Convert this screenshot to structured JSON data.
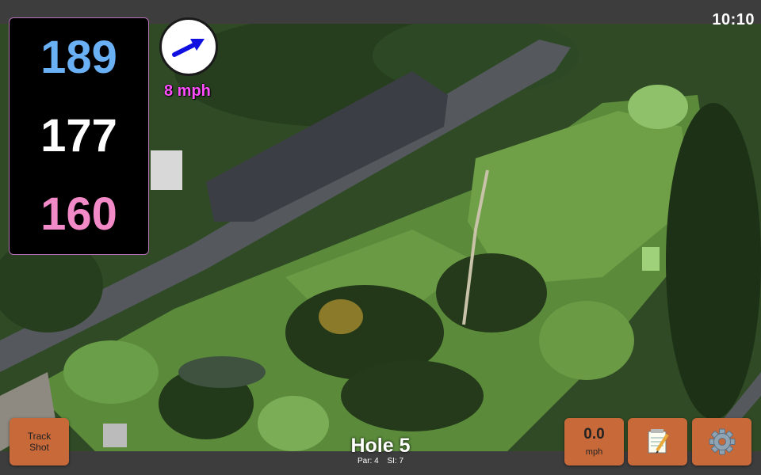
{
  "status": {
    "clock": "10:10"
  },
  "distances": {
    "back": "189",
    "center": "177",
    "front": "160",
    "colors": {
      "back": "#6ab0f5",
      "center": "#ffffff",
      "front": "#f38ac8"
    }
  },
  "wind": {
    "speed_label": "8 mph",
    "arrow_color": "#1010e0"
  },
  "buttons": {
    "track_shot_line1": "Track",
    "track_shot_line2": "Shot",
    "speed_value": "0.0",
    "speed_unit": "mph",
    "notes_icon": "notepad-icon",
    "settings_icon": "gear-icon",
    "color": "#c8693a"
  },
  "hole": {
    "title": "Hole 5",
    "par": "Par: 4",
    "si": "SI: 7"
  }
}
